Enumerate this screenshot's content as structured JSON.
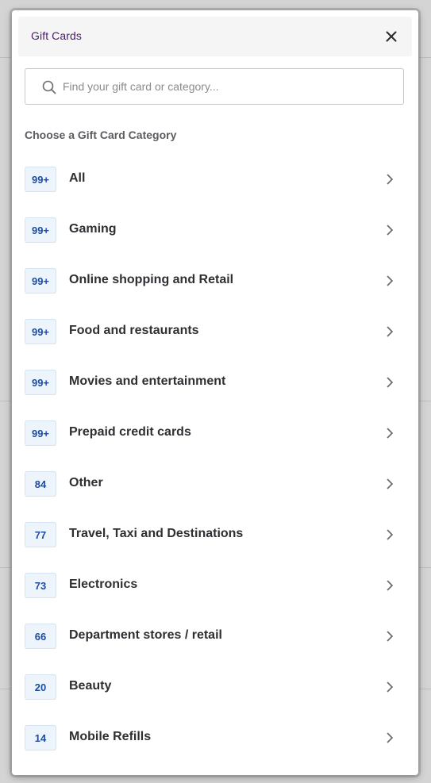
{
  "modal": {
    "title": "Gift Cards",
    "close_label": "×"
  },
  "search": {
    "placeholder": "Find your gift card or category...",
    "value": ""
  },
  "section": {
    "label": "Choose a Gift Card Category"
  },
  "categories": [
    {
      "count": "99+",
      "name": "All"
    },
    {
      "count": "99+",
      "name": "Gaming"
    },
    {
      "count": "99+",
      "name": "Online shopping and Retail"
    },
    {
      "count": "99+",
      "name": "Food and restaurants"
    },
    {
      "count": "99+",
      "name": "Movies and entertainment"
    },
    {
      "count": "99+",
      "name": "Prepaid credit cards"
    },
    {
      "count": "84",
      "name": "Other"
    },
    {
      "count": "77",
      "name": "Travel, Taxi and Destinations"
    },
    {
      "count": "73",
      "name": "Electronics"
    },
    {
      "count": "66",
      "name": "Department stores / retail"
    },
    {
      "count": "20",
      "name": "Beauty"
    },
    {
      "count": "14",
      "name": "Mobile Refills"
    }
  ],
  "colors": {
    "title": "#4a1a6b",
    "badge_text": "#1d4e9e",
    "badge_bg": "#eef4fb",
    "header_bg": "#f5f5f6"
  },
  "icons": {
    "close": "close-icon",
    "search": "search-icon",
    "chevron": "chevron-right-icon"
  }
}
